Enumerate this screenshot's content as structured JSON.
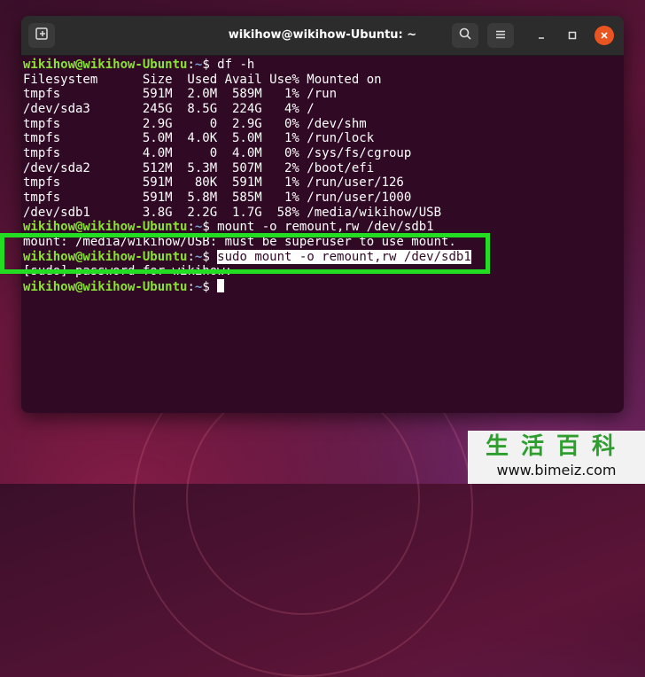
{
  "window": {
    "title": "wikihow@wikihow-Ubuntu: ~",
    "icons": {
      "new_tab": "new-tab-icon",
      "search": "search-icon",
      "menu": "hamburger-menu-icon",
      "minimize": "minimize-icon",
      "maximize": "maximize-icon",
      "close": "close-icon"
    },
    "colors": {
      "terminal_bg": "#300a24",
      "prompt_user": "#8ae234",
      "prompt_path": "#729fcf",
      "close_button": "#e95420",
      "highlight_box": "#22dd22"
    }
  },
  "terminal": {
    "prompt": {
      "user": "wikihow@wikihow-Ubuntu",
      "sep": ":",
      "path": "~",
      "symbol": "$ "
    },
    "cmd_df": "df -h",
    "df_header": "Filesystem      Size  Used Avail Use% Mounted on",
    "df_rows": [
      "tmpfs           591M  2.0M  589M   1% /run",
      "/dev/sda3       245G  8.5G  224G   4% /",
      "tmpfs           2.9G     0  2.9G   0% /dev/shm",
      "tmpfs           5.0M  4.0K  5.0M   1% /run/lock",
      "tmpfs           4.0M     0  4.0M   0% /sys/fs/cgroup",
      "/dev/sda2       512M  5.3M  507M   2% /boot/efi",
      "tmpfs           591M   80K  591M   1% /run/user/126",
      "tmpfs           591M  5.8M  585M   1% /run/user/1000",
      "/dev/sdb1       3.8G  2.2G  1.7G  58% /media/wikihow/USB"
    ],
    "cmd_mount": "mount -o remount,rw /dev/sdb1",
    "error_line": "mount: /media/wikihow/USB: must be superuser to use mount.",
    "cmd_sudo": "sudo mount -o remount,rw /dev/sdb1",
    "sudo_prompt": "[sudo] password for wikihow:"
  },
  "watermark": {
    "chars": "生活百科",
    "url": "www.bimeiz.com"
  }
}
